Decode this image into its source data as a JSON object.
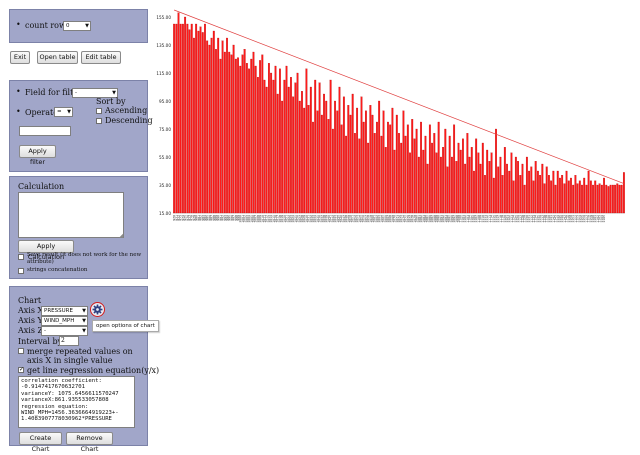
{
  "count_rows": {
    "label": "count rows:",
    "value": "0"
  },
  "toolbar": {
    "exit": "Exit",
    "open_table": "Open table",
    "edit_table": "Edit table"
  },
  "filter": {
    "field_label": "Field for filter:",
    "field_value": "-",
    "operator_label": "Operator",
    "operator_value": "=",
    "sort_by": "Sort by",
    "ascending": "Ascending",
    "descending": "Descending",
    "value": "",
    "apply": "Apply filter"
  },
  "calculation": {
    "title": "Calculation",
    "apply": "Apply Calculation",
    "save_result": "Save result (it does not work for the new attribute)",
    "strings_concat": "strings concatenation"
  },
  "chart_panel": {
    "title": "Chart",
    "axis_x_label": "Axis X",
    "axis_x_value": "PRESSURE",
    "axis_y_label": "Axis Y",
    "axis_y_value": "WIND_MPH",
    "axis_z_label": "Axis Z",
    "axis_z_value": "-",
    "interval_label": "Interval by X",
    "interval_value": "2",
    "merge_label": "merge repeated values on axis X in single value",
    "regression_label": "get line regression equation(y/x)",
    "regression_checked": true,
    "output": "correlation coefficient:\n-0.9147417670632701\nvarianceY: 1075.6456611570247\nvarianceX:861.935533057808\nregression equation:\nWIND_MPH=1456.3636664919223+-\n1.4083907778030962*PRESSURE",
    "create": "Create Chart",
    "remove": "Remove Chart",
    "tooltip": "open options of chart"
  },
  "chart_data": {
    "type": "bar",
    "bar_color": "#ff1a1a",
    "bar_edge_color": "#b00000",
    "trend_color": "#e04040",
    "ylim": [
      15,
      160
    ],
    "yticks": [
      15,
      35,
      55,
      75,
      95,
      115,
      135,
      155
    ],
    "ytick_labels": [
      "15.00",
      "35.00",
      "55.00",
      "75.00",
      "95.00",
      "115.00",
      "135.00",
      "155.00"
    ],
    "trend": {
      "y_start": 160,
      "y_end": 36
    },
    "categories": [
      "970",
      "971",
      "972",
      "973",
      "974",
      "975",
      "976",
      "977",
      "978",
      "979",
      "980",
      "981",
      "982",
      "983",
      "984",
      "985",
      "986",
      "987",
      "988",
      "989",
      "990",
      "991",
      "992",
      "993",
      "994",
      "995",
      "996",
      "997",
      "998",
      "999",
      "1000",
      "1001",
      "1002",
      "1003",
      "1004",
      "1005",
      "1006",
      "1007",
      "1008",
      "1009",
      "1010",
      "1011",
      "1012",
      "1013",
      "1014",
      "1015",
      "1016",
      "1017",
      "1018",
      "1019",
      "1020",
      "1021",
      "1022",
      "1023",
      "1024",
      "1025",
      "1026",
      "1027",
      "1028",
      "1029",
      "1030",
      "1031",
      "1032",
      "1033",
      "1034",
      "1035",
      "1036",
      "1037",
      "1038",
      "1039",
      "1040",
      "1041",
      "1042",
      "1043",
      "1044",
      "1045",
      "1046",
      "1047",
      "1048",
      "1049",
      "1050",
      "1051",
      "1052",
      "1053",
      "1054",
      "1055",
      "1056",
      "1057",
      "1058",
      "1059",
      "1060",
      "1061",
      "1062",
      "1063",
      "1064",
      "1065",
      "1066",
      "1067",
      "1068",
      "1069",
      "1070",
      "1071",
      "1072",
      "1073",
      "1074",
      "1075",
      "1076",
      "1077",
      "1078",
      "1079",
      "1080",
      "1081",
      "1082",
      "1083",
      "1084",
      "1085",
      "1086",
      "1087",
      "1088",
      "1089",
      "1090",
      "1091",
      "1092",
      "1093",
      "1094",
      "1095",
      "1096",
      "1097",
      "1098",
      "1099",
      "1100",
      "1101",
      "1102",
      "1103",
      "1104",
      "1105",
      "1106",
      "1107",
      "1108",
      "1109",
      "1110",
      "1111",
      "1112",
      "1113",
      "1114",
      "1115",
      "1116",
      "1117",
      "1118",
      "1119",
      "1120",
      "1121",
      "1122",
      "1123",
      "1124",
      "1125",
      "1126",
      "1127",
      "1128",
      "1129",
      "1130",
      "1131",
      "1132",
      "1133",
      "1134",
      "1135",
      "1136",
      "1137",
      "1138",
      "1139",
      "1140",
      "1141",
      "1142",
      "1143",
      "1144",
      "1145",
      "1146",
      "1147",
      "1148",
      "1149",
      "1150",
      "1151",
      "1152",
      "1153",
      "1154",
      "1155",
      "1156",
      "1157",
      "1158",
      "1159",
      "1160",
      "1161",
      "1162",
      "1163",
      "1164",
      "1165"
    ],
    "values": [
      150,
      150,
      158,
      150,
      150,
      155,
      150,
      146,
      150,
      140,
      150,
      145,
      148,
      144,
      150,
      138,
      135,
      140,
      145,
      132,
      140,
      125,
      138,
      130,
      140,
      130,
      128,
      135,
      125,
      126,
      120,
      128,
      132,
      122,
      118,
      125,
      130,
      120,
      112,
      124,
      128,
      110,
      105,
      122,
      115,
      110,
      120,
      100,
      118,
      95,
      110,
      120,
      105,
      112,
      98,
      108,
      115,
      95,
      102,
      90,
      118,
      92,
      105,
      80,
      110,
      88,
      108,
      85,
      100,
      95,
      82,
      110,
      75,
      95,
      88,
      105,
      78,
      98,
      70,
      92,
      85,
      100,
      72,
      90,
      68,
      98,
      80,
      88,
      65,
      92,
      85,
      72,
      80,
      95,
      70,
      88,
      62,
      80,
      78,
      90,
      60,
      85,
      72,
      65,
      88,
      70,
      78,
      58,
      82,
      68,
      75,
      55,
      80,
      60,
      70,
      50,
      78,
      65,
      72,
      58,
      80,
      55,
      62,
      75,
      48,
      70,
      55,
      78,
      52,
      65,
      60,
      68,
      50,
      72,
      55,
      62,
      45,
      68,
      58,
      50,
      65,
      42,
      60,
      52,
      58,
      40,
      75,
      48,
      55,
      42,
      62,
      50,
      45,
      58,
      38,
      55,
      52,
      42,
      50,
      35,
      55,
      45,
      48,
      38,
      52,
      45,
      42,
      50,
      36,
      48,
      42,
      38,
      45,
      35,
      45,
      40,
      42,
      36,
      45,
      38,
      40,
      35,
      42,
      36,
      38,
      35,
      40,
      35,
      45,
      38,
      35,
      38,
      35,
      36,
      35,
      40,
      35,
      34,
      35,
      35,
      35,
      36,
      35,
      35,
      44
    ]
  }
}
